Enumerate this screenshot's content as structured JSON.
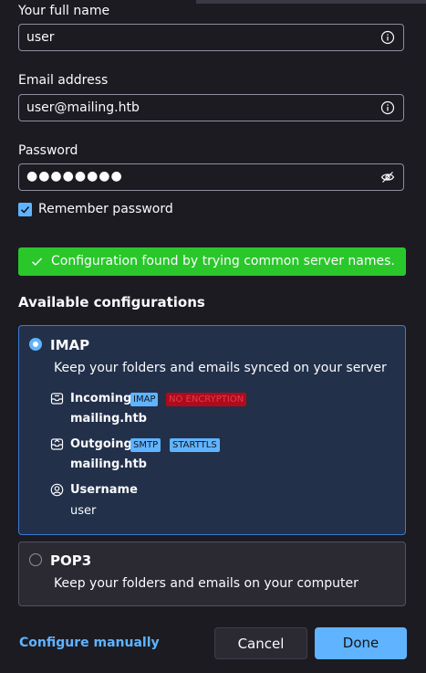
{
  "form": {
    "name_label": "Your full name",
    "name_value": "user",
    "email_label": "Email address",
    "email_value": "user@mailing.htb",
    "password_label": "Password",
    "password_value": "●●●●●●●●",
    "remember_label": "Remember password",
    "remember_checked": true
  },
  "status": {
    "message": "Configuration found by trying common server names.",
    "color": "#2ac72a"
  },
  "configs": {
    "title": "Available configurations",
    "imap": {
      "name": "IMAP",
      "description": "Keep your folders and emails synced on your server",
      "incoming_label": "Incoming",
      "incoming_badges": [
        "IMAP",
        "NO ENCRYPTION"
      ],
      "incoming_host": "mailing.htb",
      "outgoing_label": "Outgoing",
      "outgoing_badges": [
        "SMTP",
        "STARTTLS"
      ],
      "outgoing_host": "mailing.htb",
      "username_label": "Username",
      "username_value": "user",
      "selected": true
    },
    "pop3": {
      "name": "POP3",
      "description": "Keep your folders and emails on your computer",
      "selected": false
    }
  },
  "footer": {
    "configure_manually": "Configure manually",
    "cancel": "Cancel",
    "done": "Done"
  },
  "colors": {
    "accent": "#60b4ff",
    "background": "#1c1b22",
    "warning_badge": "#b00b1a"
  }
}
